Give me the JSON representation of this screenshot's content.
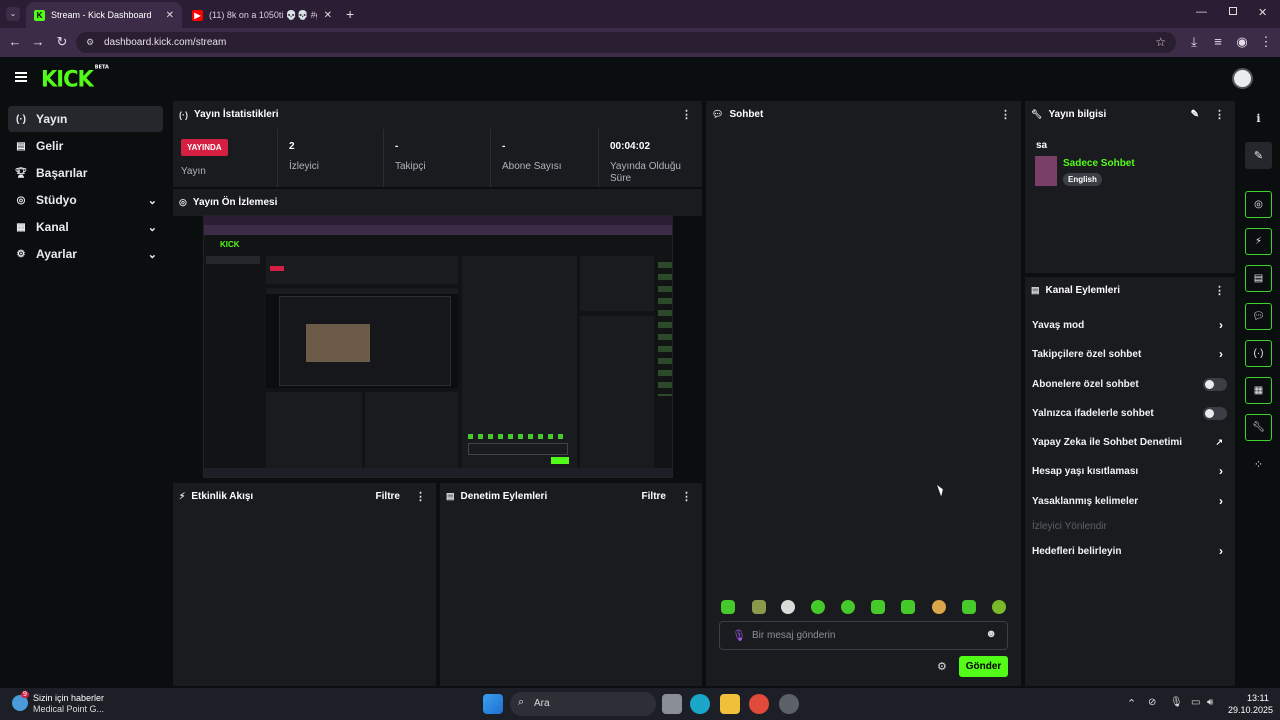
{
  "browser": {
    "tabs": [
      {
        "title": "Stream - Kick Dashboard",
        "active": true
      },
      {
        "title": "(11) 8k on a 1050ti 💀💀 #gan",
        "active": false
      }
    ],
    "url": "dashboard.kick.com/stream"
  },
  "app": {
    "logo": "KICK",
    "logo_badge": "BETA"
  },
  "sidebar": {
    "items": [
      {
        "label": "Yayın",
        "icon": "broadcast-icon",
        "selected": true
      },
      {
        "label": "Gelir",
        "icon": "revenue-icon"
      },
      {
        "label": "Başarılar",
        "icon": "trophy-icon"
      },
      {
        "label": "Stüdyo",
        "icon": "studio-icon",
        "expandable": true
      },
      {
        "label": "Kanal",
        "icon": "channel-icon",
        "expandable": true
      },
      {
        "label": "Ayarlar",
        "icon": "gear-icon",
        "expandable": true
      }
    ]
  },
  "stats": {
    "title": "Yayın İstatistikleri",
    "live_badge": "YAYINDA",
    "live_label": "Yayın",
    "cells": [
      {
        "value": "2",
        "label": "İzleyici"
      },
      {
        "value": "-",
        "label": "Takipçi"
      },
      {
        "value": "-",
        "label": "Abone Sayısı"
      },
      {
        "value": "00:04:02",
        "label": "Yayında Olduğu Süre"
      }
    ]
  },
  "preview": {
    "title": "Yayın Ön İzlemesi"
  },
  "activity": {
    "title": "Etkinlik Akışı",
    "filter": "Filtre"
  },
  "moderation": {
    "title": "Denetim Eylemleri",
    "filter": "Filtre"
  },
  "chat": {
    "title": "Sohbet",
    "placeholder": "Bir mesaj gönderin",
    "send": "Gönder"
  },
  "stream_info": {
    "title": "Yayın bilgisi",
    "stream_title": "sa",
    "category": "Sadece Sohbet",
    "language": "English"
  },
  "channel_actions": {
    "title": "Kanal Eylemleri",
    "items": [
      {
        "label": "Yavaş mod",
        "type": "chevron"
      },
      {
        "label": "Takipçilere özel sohbet",
        "type": "chevron"
      },
      {
        "label": "Abonelere özel sohbet",
        "type": "toggle",
        "on": false
      },
      {
        "label": "Yalnızca ifadelerle sohbet",
        "type": "toggle",
        "on": false
      },
      {
        "label": "Yapay Zeka ile Sohbet Denetimi",
        "type": "external"
      },
      {
        "label": "Hesap yaşı kısıtlaması",
        "type": "chevron"
      },
      {
        "label": "Yasaklanmış kelimeler",
        "type": "chevron"
      },
      {
        "label": "İzleyici Yönlendir",
        "type": "disabled"
      },
      {
        "label": "Hedefleri belirleyin",
        "type": "chevron"
      }
    ]
  },
  "taskbar": {
    "news_title": "Sizin için haberler",
    "news_sub": "Medical Point G...",
    "news_badge": "9",
    "search": "Ara",
    "time": "13:11",
    "date": "29.10.2025"
  },
  "colors": {
    "accent": "#53fc18",
    "live": "#d51f43",
    "panel": "#191b1f"
  }
}
